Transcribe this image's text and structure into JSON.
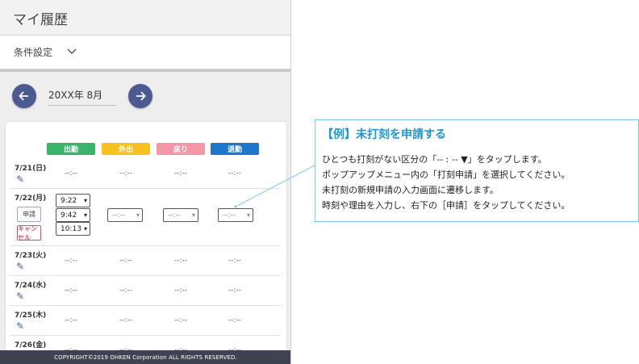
{
  "header": {
    "title": "マイ履歴"
  },
  "conditions": {
    "label": "条件設定",
    "chevron_icon": "chevron-down-icon"
  },
  "month_nav": {
    "label": "20XX年 8月",
    "prev_icon": "arrow-left-icon",
    "next_icon": "arrow-right-icon"
  },
  "columns": {
    "clock_in": "出勤",
    "go_out": "外出",
    "return": "戻り",
    "clock_out": "退勤"
  },
  "colors": {
    "clock_in": "#3cb26b",
    "go_out": "#f7c21f",
    "return": "#f397a6",
    "clock_out": "#1f77c9",
    "accent": "#4d5a92"
  },
  "days": [
    {
      "date": "7/21(日)",
      "s1": "--:--",
      "s2": "--:--",
      "s3": "--:--",
      "s4": "--:--"
    },
    {
      "date": "7/22(月)",
      "apply_label": "申請",
      "cancel_label": "キャンセル",
      "times": [
        "9:22",
        "9:42",
        "10:13"
      ],
      "s2": "--:--",
      "s3": "--:--",
      "s4": "--:--"
    },
    {
      "date": "7/23(火)",
      "s1": "--:--",
      "s2": "--:--",
      "s3": "--:--",
      "s4": "--:--"
    },
    {
      "date": "7/24(水)",
      "s1": "--:--",
      "s2": "--:--",
      "s3": "--:--",
      "s4": "--:--"
    },
    {
      "date": "7/25(木)",
      "s1": "--:--",
      "s2": "--:--",
      "s3": "--:--",
      "s4": "--:--"
    },
    {
      "date": "7/26(金)",
      "s1": "--:--",
      "s2": "--:--",
      "s3": "--:--",
      "s4": "--:--"
    }
  ],
  "footer": {
    "text": "COPYRIGHT©2019 OHKEN Corporation ALL RIGHTS RESERVED."
  },
  "callout": {
    "title": "【例】未打刻を申請する",
    "lines": [
      "ひとつも打刻がない区分の「-- : -- ▼」をタップします。",
      "ポップアップメニュー内の「打刻申請」を選択してください。",
      "未打刻の新規申請の入力画面に遷移します。",
      "時刻や理由を入力し、右下の［申請］をタップしてください。"
    ]
  }
}
